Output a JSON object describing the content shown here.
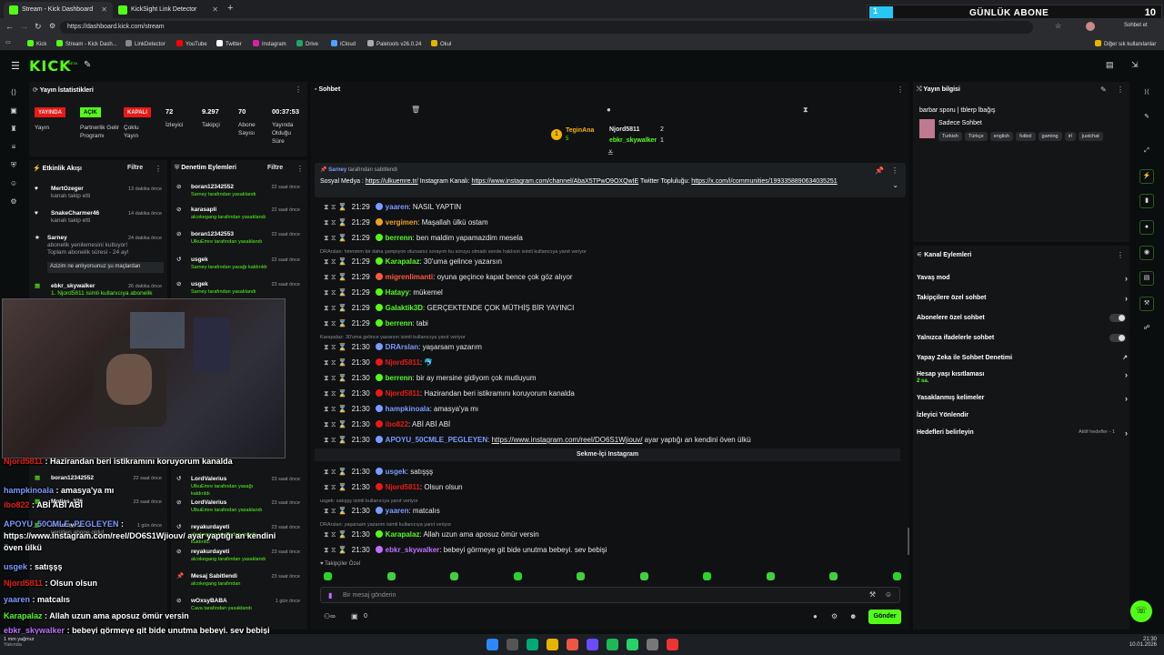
{
  "browser": {
    "tabs": [
      {
        "title": "Stream - Kick Dashboard"
      },
      {
        "title": "KickSight Link Detector"
      }
    ],
    "url": "https://dashboard.kick.com/stream",
    "bookmarks": [
      "Kick",
      "Stream - Kick Dash...",
      "LinkDetector",
      "YouTube",
      "Twitter",
      "Instagram",
      "Drive",
      "iCloud",
      "Paletools v26.0.24",
      "Okul"
    ],
    "other_bookmarks": "Diğer sık kullanılanlar",
    "profile_label": "Sohbet et"
  },
  "overlay_banner": {
    "label": "GÜNLÜK ABONE",
    "count": "10",
    "progress_digit": "1"
  },
  "kick": {
    "logo": "KICK",
    "beta": "BETA"
  },
  "stats": {
    "title": "Yayın İstatistikleri",
    "badges": [
      {
        "label": "YAYINDA",
        "caption": "Yayın",
        "color": "#e91916"
      },
      {
        "label": "AÇIK",
        "caption": "Partnerlik Gelir Programı",
        "color": "#53fc18"
      },
      {
        "label": "KAPALI",
        "caption": "Çoklu Yayın",
        "color": "#e91916"
      }
    ],
    "numbers": [
      {
        "value": "72",
        "label": "İzleyici"
      },
      {
        "value": "9.297",
        "label": "Takipçi"
      },
      {
        "value": "70",
        "label": "Abone Sayısı"
      },
      {
        "value": "00:37:53",
        "label": "Yayında Olduğu Süre"
      }
    ]
  },
  "activity": {
    "title": "Etkinlik Akışı",
    "filter": "Filtre",
    "items": [
      {
        "user": "MertOzeger",
        "text": "kanalı takip etti",
        "time": "13 dakika önce"
      },
      {
        "user": "SnakeCharmer46",
        "text": "kanalı takip etti",
        "time": "14 dakika önce"
      },
      {
        "user": "Sarney",
        "text": "abonelik yenilemesini kutluyor! Toplam abonelik süresi - 24 ay!",
        "time": "24 dakika önce",
        "quote": "Azizim ne anlıyorsunuz şu maçlardan"
      },
      {
        "user": "ebkr_skywalker",
        "text": "1. Njord5811 isimli kullanıcıya abonelik",
        "time": "26 dakika önce"
      },
      {
        "user": "boran12342552",
        "text": "",
        "time": "22 saat önce"
      },
      {
        "user": "Moties_376",
        "text": "",
        "time": "23 saat önce"
      },
      {
        "user": "Dwarloves",
        "text": "yeniden abone oldu!",
        "time": "1 gün önce"
      }
    ]
  },
  "moderation": {
    "title": "Denetim Eylemleri",
    "filter": "Filtre",
    "items": [
      {
        "user": "boran12342552",
        "text": "Sarney tarafından yasaklandı",
        "time": "22 saat önce"
      },
      {
        "user": "karasapli",
        "text": "alcokegang tarafından yasaklandı",
        "time": "22 saat önce"
      },
      {
        "user": "boran12342553",
        "text": "UlkuEmre tarafından yasaklandı",
        "time": "22 saat önce"
      },
      {
        "user": "usgek",
        "text": "Sarney tarafından yasağı kaldırıldı",
        "time": "22 saat önce"
      },
      {
        "user": "usgek",
        "text": "Sarney tarafından yasaklandı",
        "time": "23 saat önce"
      },
      {
        "user": "LordValerius",
        "text": "UlkuEmre tarafından yasağı kaldırıldı",
        "time": "23 saat önce"
      },
      {
        "user": "LordValerius",
        "text": "UlkuEmre tarafından yasaklandı",
        "time": "23 saat önce"
      },
      {
        "user": "reyakurdayeti",
        "text": "alcokegang tarafından yasağı kaldırıldı",
        "time": "23 saat önce"
      },
      {
        "user": "reyakurdayeti",
        "text": "alcokegang tarafından yasaklandı",
        "time": "23 saat önce"
      },
      {
        "user": "Mesaj Sabitlendi",
        "text": "alcokegang tarafından",
        "time": "23 saat önce"
      },
      {
        "user": "wOxsyBABA",
        "text": "Cava tarafından yasaklandı",
        "time": "1 gün önce"
      }
    ]
  },
  "chat": {
    "title": "Sohbet",
    "top_gifters": [
      {
        "rank": "1",
        "name": "TeginAna",
        "count": "5"
      },
      {
        "name": "Njord5811",
        "count": "2"
      },
      {
        "name": "ebkr_skywalker",
        "count": "1"
      }
    ],
    "pinned": {
      "by": "Sarney",
      "by_suffix": "tarafından sabitlendi",
      "text_prefix": "Sosyal Medya : ",
      "link1": "https://ulkuemre.tr/",
      "mid": " Instagram Kanalı: ",
      "link2": "https://www.instagram.com/channel/AbaX5TPwO9OXQwIE",
      "mid2": " Twitter Topluluğu: ",
      "link3": "https://x.com/i/communities/1993358890634035251"
    },
    "messages": [
      {
        "time": "21:29",
        "user": "yaaren",
        "color": "#7b9cff",
        "text": "NASIL YAPTIN"
      },
      {
        "time": "21:29",
        "user": "vergimen",
        "color": "#f0a020",
        "text": "Maşallah ülkü ostam"
      },
      {
        "time": "21:29",
        "user": "berrenn",
        "color": "#53fc18",
        "text": "ben maldim yapamazdim mesela"
      },
      {
        "time": "21:29",
        "user": "Karapalaz",
        "color": "#53fc18",
        "text": "30'uma gelince yazarsın",
        "reply": "DRArslan: hmmmm bir daha şampiyon olursanız sorayım bu soruyu olmadı sende haklısın isimli kullanıcıya yanıt veriyor"
      },
      {
        "time": "21:29",
        "user": "migrenlimanti",
        "color": "#ff5a36",
        "text": "oyuna geçince kapat bence çok göz alıyor"
      },
      {
        "time": "21:29",
        "user": "Hatayy",
        "color": "#53fc18",
        "text": "mükemel"
      },
      {
        "time": "21:29",
        "user": "Galaktik3D",
        "color": "#53fc18",
        "text": "GERÇEKTENDE ÇOK MÜTHİŞ BİR YAYINCI"
      },
      {
        "time": "21:29",
        "user": "berrenn",
        "color": "#53fc18",
        "text": "tabi"
      },
      {
        "time": "21:30",
        "user": "DRArslan",
        "color": "#7b9cff",
        "text": "yaşarsam yazarım",
        "reply": "Karapalaz: 30'uma gelince yazarsın isimli kullanıcıya yanıt veriyor"
      },
      {
        "time": "21:30",
        "user": "Njord5811",
        "color": "#e91916",
        "text": "🐬"
      },
      {
        "time": "21:30",
        "user": "berrenn",
        "color": "#53fc18",
        "text": "bir ay mersine gidiyom çok mutluyum"
      },
      {
        "time": "21:30",
        "user": "Njord5811",
        "color": "#e91916",
        "text": "Hazirandan beri istikramını koruyorum kanalda"
      },
      {
        "time": "21:30",
        "user": "hampkinoala",
        "color": "#7b9cff",
        "text": "amasya'ya mı"
      },
      {
        "time": "21:30",
        "user": "ibo822",
        "color": "#e91916",
        "text": "ABİ ABİ ABİ"
      },
      {
        "time": "21:30",
        "user": "APOYU_50CMLE_PEGLEYEN",
        "color": "#7b9cff",
        "text": "https://www.instagram.com/reel/DO6S1Wjiouv/",
        "text2": " ayar yaptığı an kendini öven ülkü"
      }
    ],
    "instagram_sep": "Sekme-İçi Instagram",
    "messages2": [
      {
        "time": "21:30",
        "user": "usgek",
        "color": "#7b9cff",
        "text": "satışşş"
      },
      {
        "time": "21:30",
        "user": "Njord5811",
        "color": "#e91916",
        "text": "Olsun olsun"
      },
      {
        "time": "21:30",
        "user": "yaaren",
        "color": "#7b9cff",
        "text": "matcalıs",
        "reply": "usgek: satışşş isimli kullanıcıya yanıt veriyor"
      },
      {
        "time": "21:30",
        "user": "Karapalaz",
        "color": "#53fc18",
        "text": "Allah uzun ama aposuz ömür versin",
        "reply": "DRArslan: yaşarsam yazarım isimli kullanıcıya yanıt veriyor"
      },
      {
        "time": "21:30",
        "user": "ebkr_skywalker",
        "color": "#c070ff",
        "text": "bebeyi görmeye git bide unutma bebeyi. sev bebişi"
      }
    ],
    "followers_only": "Takipçiler Özel",
    "input_placeholder": "Bir mesaj gönderin",
    "send_label": "Gönder",
    "viewer_count": "0"
  },
  "stream_info": {
    "title": "Yayın bilgisi",
    "stream_title": "barbar sporu | tblerp lbağış",
    "category": "Sadece Sohbet",
    "tags": [
      "Turkish",
      "Türkçe",
      "english",
      "futbol",
      "gaming",
      "irl",
      "justchat"
    ]
  },
  "channel_actions": {
    "title": "Kanal Eylemleri",
    "items": [
      {
        "label": "Yavaş mod",
        "type": "chevron"
      },
      {
        "label": "Takipçilere özel sohbet",
        "type": "chevron"
      },
      {
        "label": "Abonelere özel sohbet",
        "type": "toggle"
      },
      {
        "label": "Yalnızca ifadelerle sohbet",
        "type": "toggle"
      },
      {
        "label": "Yapay Zeka ile Sohbet Denetimi",
        "type": "external"
      },
      {
        "label": "Hesap yaşı kısıtlaması",
        "sub": "2 sa.",
        "type": "chevron"
      },
      {
        "label": "Yasaklanmış kelimeler",
        "type": "chevron"
      },
      {
        "label": "İzleyici Yönlendir",
        "type": "none"
      },
      {
        "label": "Hedefleri belirleyin",
        "note": "Aktif hedefler - 1",
        "type": "chevron"
      }
    ]
  },
  "webcam_overlay": [
    {
      "user": "Njord5811",
      "text": "Hazirandan beri istikramını koruyorum kanalda",
      "color": "#e91916"
    },
    {
      "user": "hampkinoala",
      "text": "amasya'ya mı",
      "color": "#7b9cff"
    },
    {
      "user": "ibo822",
      "text": "ABİ ABİ ABİ",
      "color": "#e91916"
    },
    {
      "user": "APOYU_50CMLE_PEGLEYEN",
      "text": "https://www.instagram.com/reel/DO6S1Wjiouv/ ayar yaptığı an kendini öven ülkü",
      "color": "#7b9cff"
    },
    {
      "user": "usgek",
      "text": "satışşş",
      "color": "#7b9cff"
    },
    {
      "user": "Njord5811",
      "text": "Olsun olsun",
      "color": "#e91916"
    },
    {
      "user": "yaaren",
      "text": "matcalıs",
      "color": "#7b9cff"
    },
    {
      "user": "Karapalaz",
      "text": "Allah uzun ama aposuz ömür versin",
      "color": "#53fc18"
    },
    {
      "user": "ebkr_skywalker",
      "text": "bebeyi görmeye git bide unutma bebeyi. sev bebişi",
      "color": "#c070ff"
    }
  ],
  "taskbar": {
    "time": "21:30",
    "date": "10.01.2026",
    "weather": "1 mm yağmur",
    "weather_sub": "Yakında"
  }
}
